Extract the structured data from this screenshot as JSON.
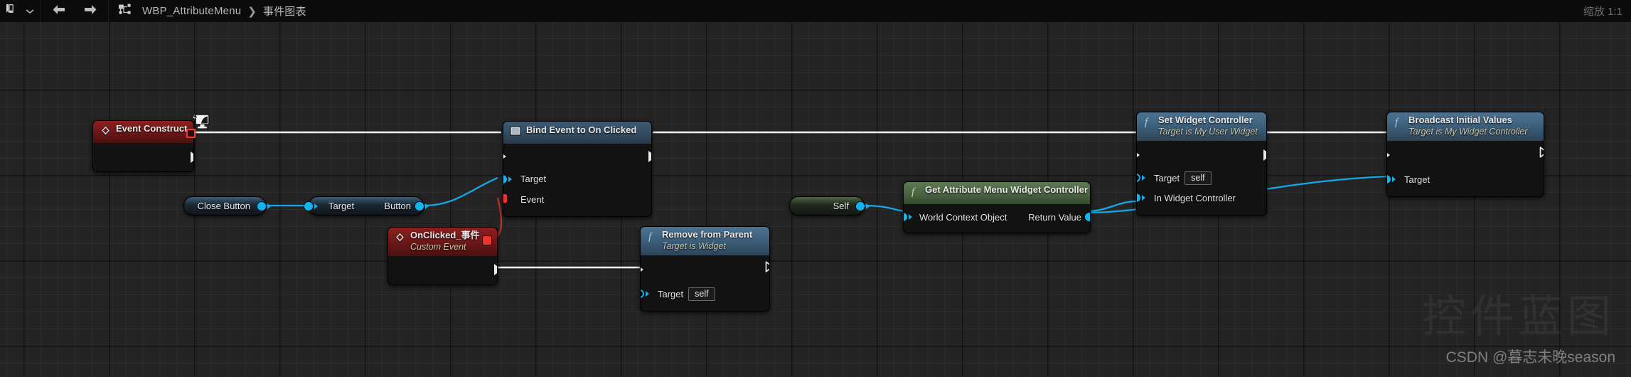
{
  "toolbar": {
    "bookmark_icon": "bookmark-icon",
    "dropdown_icon": "chevron-down-icon",
    "back_icon": "arrow-left-icon",
    "forward_icon": "arrow-right-icon",
    "graph_icon": "blueprint-graph-icon",
    "breadcrumb_root": "WBP_AttributeMenu",
    "breadcrumb_sep": "❯",
    "breadcrumb_leaf": "事件图表",
    "zoom_label": "缩放 1:1"
  },
  "watermark": {
    "big": "控件蓝图",
    "small": "CSDN @暮志未晚season"
  },
  "colors": {
    "exec_wire": "#f0f0f0",
    "data_wire": "#13a9e6",
    "delegate_wire": "#c1322c",
    "event_header": "#8d1f1f",
    "function_header": "#3b5c77",
    "pure_function_header": "#47603f",
    "canvas": "#242424"
  },
  "nodes": {
    "event_construct": {
      "title": "Event Construct",
      "icon": "event-diamond-icon",
      "badge_icon": "debug-screen-icon",
      "exec_out": "exec-out-pin"
    },
    "close_button": {
      "label": "Close Button",
      "out_pin": "object-out-pin"
    },
    "target_button": {
      "in_label": "Target",
      "out_label": "Button"
    },
    "bind_event": {
      "title": "Bind Event to On Clicked",
      "icon": "bind-event-icon",
      "rows": [
        {
          "label": "Target",
          "pin": "object-in-pin"
        },
        {
          "label": "Event",
          "pin": "delegate-in-pin"
        }
      ]
    },
    "on_clicked_event": {
      "title": "OnClicked_事件",
      "subtitle": "Custom Event",
      "icon": "event-diamond-icon",
      "delegate_pin": "delegate-out-pin"
    },
    "remove_from_parent": {
      "title": "Remove from Parent",
      "subtitle": "Target is Widget",
      "icon": "function-f-icon",
      "rows": [
        {
          "label": "Target",
          "value": "self",
          "pin": "object-in-pin"
        }
      ]
    },
    "self_node": {
      "label": "Self"
    },
    "get_widget_controller": {
      "title": "Get Attribute Menu Widget Controller",
      "icon": "function-f-icon",
      "in_label": "World Context Object",
      "out_label": "Return Value"
    },
    "set_widget_controller": {
      "title": "Set Widget Controller",
      "subtitle": "Target is My User Widget",
      "icon": "function-f-icon",
      "rows": [
        {
          "label": "Target",
          "value": "self",
          "pin": "object-in-pin"
        },
        {
          "label": "In Widget Controller",
          "value": "",
          "pin": "object-in-pin"
        }
      ]
    },
    "broadcast_initial_values": {
      "title": "Broadcast Initial Values",
      "subtitle": "Target is My Widget Controller",
      "icon": "function-f-icon",
      "rows": [
        {
          "label": "Target",
          "pin": "object-in-pin"
        }
      ]
    }
  }
}
